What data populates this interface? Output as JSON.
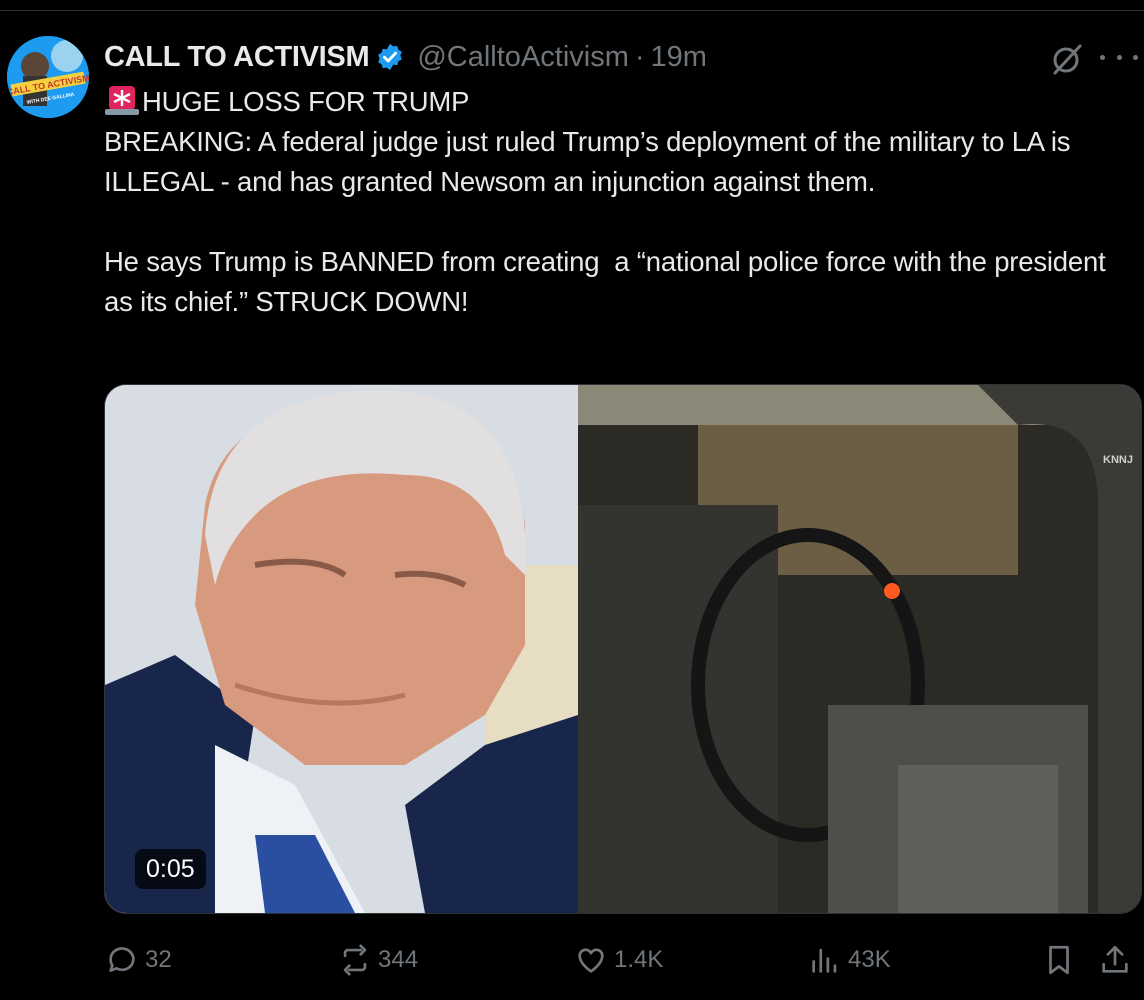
{
  "tweet": {
    "display_name": "CALL TO ACTIVISM",
    "handle": "@CalltoActivism",
    "separator": "·",
    "timestamp": "19m",
    "avatar_text_line1": "CALL TO ACTIVISM",
    "avatar_text_line2": "WITH DEE GALLINA",
    "headline": "HUGE LOSS FOR TRUMP",
    "body": "\nBREAKING: A federal judge just ruled Trump’s deployment of the military to LA is ILLEGAL - and has granted Newsom an injunction against them.\n\nHe says Trump is BANNED from creating  a “national police force with the president as its chief.” STRUCK DOWN!",
    "media": {
      "duration": "0:05",
      "watermark": "KNNJ"
    }
  },
  "actions": {
    "replies": "32",
    "reposts": "344",
    "likes": "1.4K",
    "views": "43K"
  },
  "colors": {
    "background": "#000000",
    "text_primary": "#e7e9ea",
    "text_secondary": "#71767b",
    "verified": "#1d9bf0",
    "siren": "#e0245e"
  },
  "icons": [
    "verified-badge-icon",
    "grok-icon",
    "more-icon",
    "siren-emoji-icon",
    "reply-icon",
    "repost-icon",
    "like-icon",
    "views-icon",
    "bookmark-icon",
    "share-icon"
  ]
}
